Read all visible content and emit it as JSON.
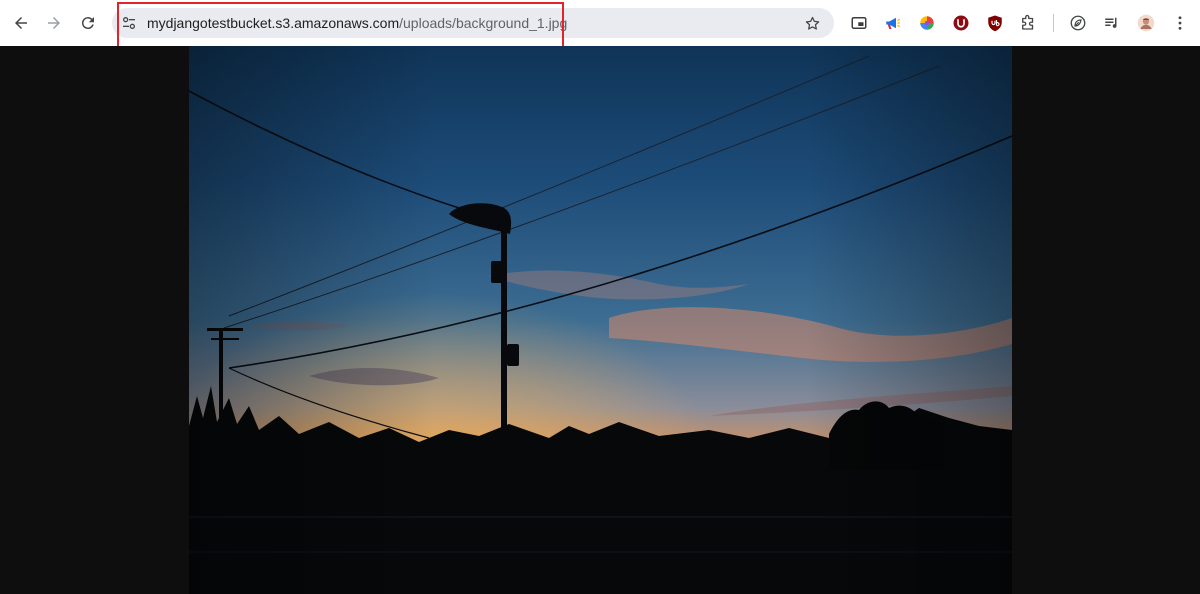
{
  "browser": {
    "nav": {
      "back_icon": "arrow-left-icon",
      "forward_icon": "arrow-right-icon",
      "reload_icon": "reload-icon"
    },
    "omnibox": {
      "site_info_icon": "tune-icon",
      "url_host": "mydjangotestbucket.s3.amazonaws.com",
      "url_path": "/uploads/background_1.jpg",
      "bookmark_icon": "star-icon"
    },
    "annotation": {
      "highlight_color": "#e2232b"
    },
    "extensions": [
      {
        "name": "picture-in-picture-icon"
      },
      {
        "name": "megaphone-icon"
      },
      {
        "name": "color-wheel-icon"
      },
      {
        "name": "u-badge-icon"
      },
      {
        "name": "ublock-origin-icon"
      },
      {
        "name": "puzzle-extensions-icon"
      },
      {
        "name": "performance-leaf-icon"
      },
      {
        "name": "media-queue-icon"
      },
      {
        "name": "profile-avatar"
      },
      {
        "name": "more-vertical-icon"
      }
    ]
  },
  "content": {
    "image_name": "background_1.jpg",
    "background_color": "#0e0e0f",
    "sky_colors": [
      "#1d4a78",
      "#3f6c91",
      "#d6865d",
      "#f1b45a"
    ]
  }
}
